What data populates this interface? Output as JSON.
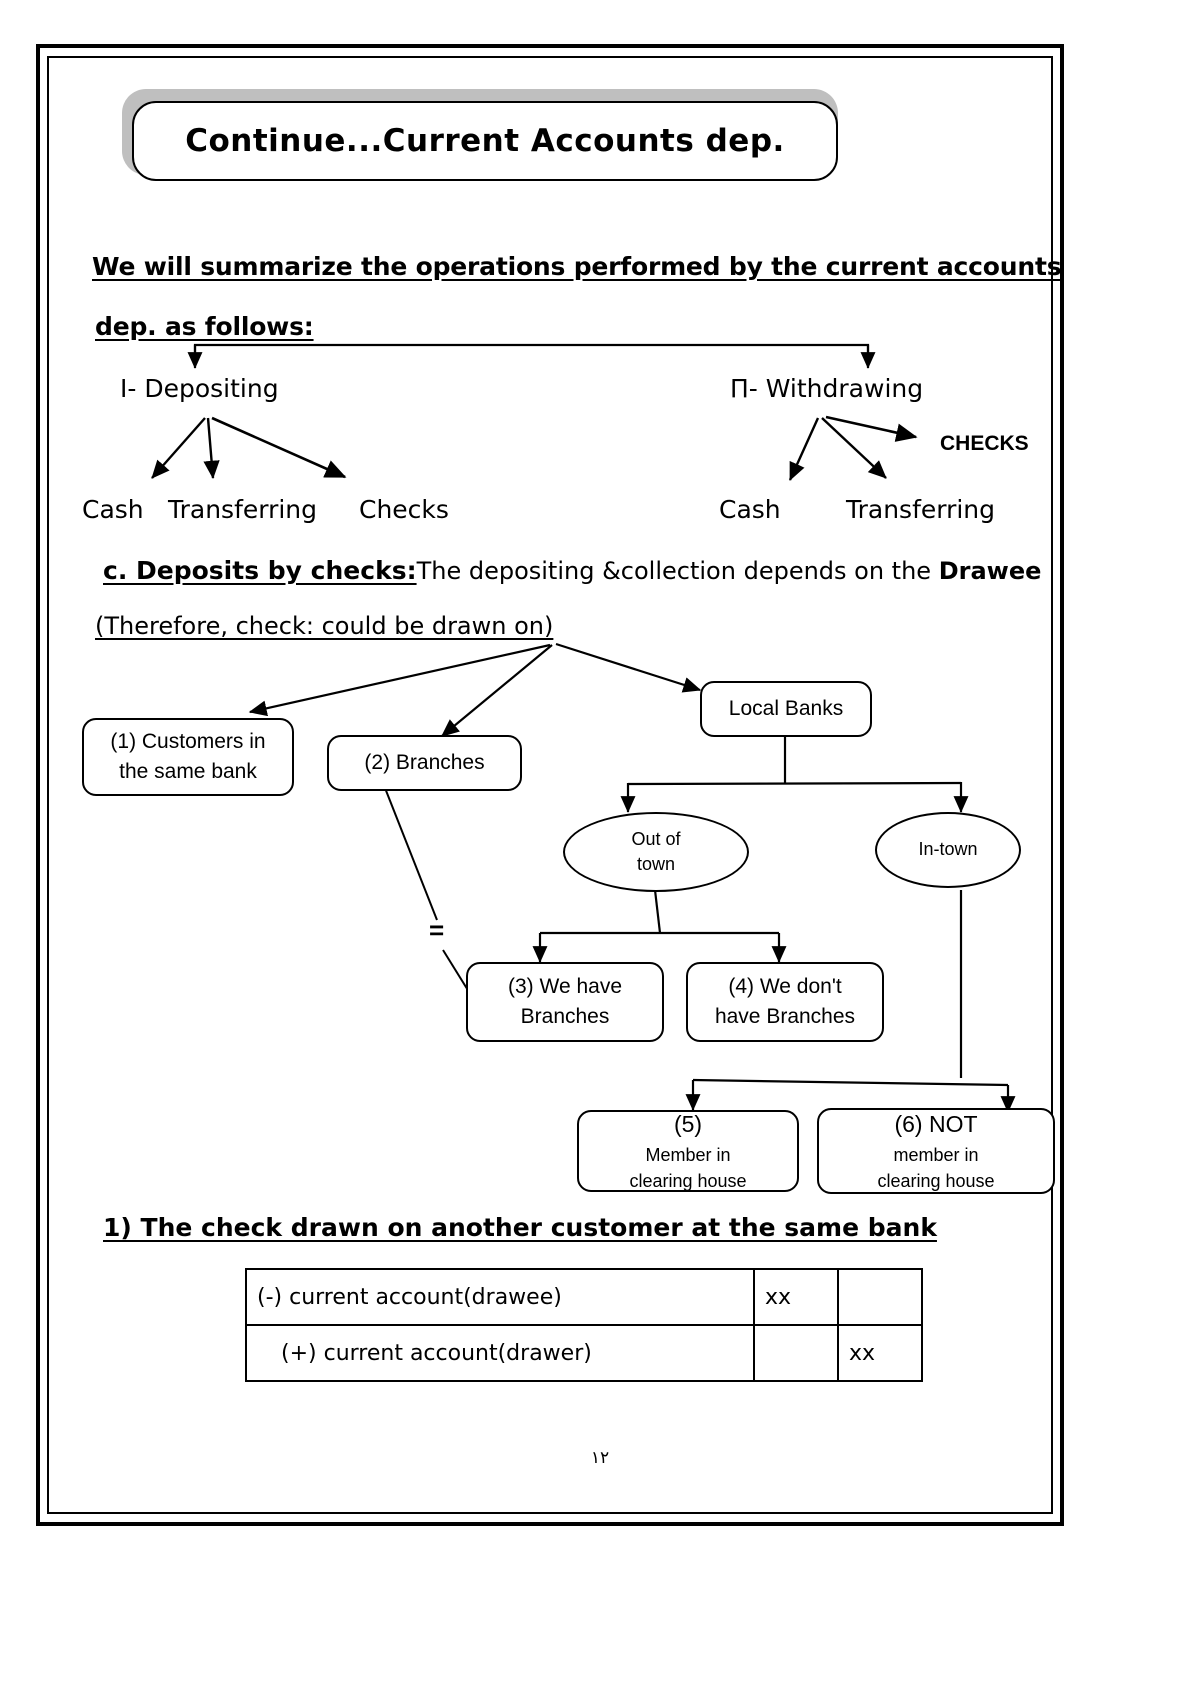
{
  "page": {
    "title": "Continue...Current Accounts dep.",
    "folio": "١٢"
  },
  "intro": {
    "line1": "We will summarize the operations performed by the current accounts",
    "line2": "dep. as follows:"
  },
  "summary_tree": {
    "left_branch": "I- Depositing",
    "right_branch": "Π- Withdrawing",
    "left_leaves": [
      "Cash",
      "Transferring",
      "Checks"
    ],
    "right_leaves": [
      "Cash",
      "Transferring"
    ],
    "right_side_label": "CHECKS"
  },
  "deposits_section": {
    "label": "c. Deposits by checks:",
    "sentence_part1": "The depositing &collection depends on the ",
    "sentence_bold": "Drawee",
    "subtitle": "(Therefore, check: could be drawn on)"
  },
  "flowchart": {
    "box1_line1": "(1) Customers in",
    "box1_line2": "the same bank",
    "box2": "(2) Branches",
    "local_banks": "Local Banks",
    "ellipse_out_line1": "Out of",
    "ellipse_out_line2": "town",
    "ellipse_in": "In-town",
    "box3_line1": "(3) We have",
    "box3_line2": "Branches",
    "box4_line1": "(4) We don't",
    "box4_line2": "have Branches",
    "box5_num": "(5)",
    "box5_line1": " Member in",
    "box5_line2": "clearing house",
    "box6_num": "(6) NOT",
    "box6_line1": " member in",
    "box6_line2": "clearing house",
    "equals_sign": "="
  },
  "entry_section": {
    "heading": "1) The check drawn on another customer at the same bank",
    "rows": [
      {
        "desc": "(-) current account(drawee)",
        "debit": "xx",
        "credit": ""
      },
      {
        "desc": "(+) current account(drawer)",
        "debit": "",
        "credit": "xx"
      }
    ]
  }
}
